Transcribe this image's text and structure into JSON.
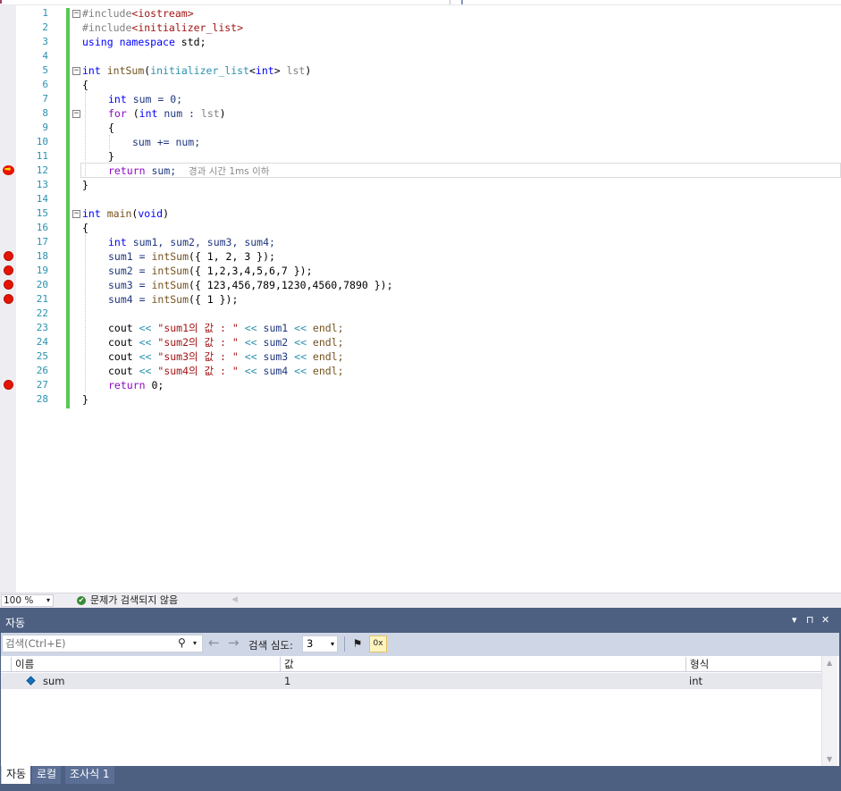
{
  "editor": {
    "line_numbers": [
      "1",
      "2",
      "3",
      "4",
      "5",
      "6",
      "7",
      "8",
      "9",
      "10",
      "11",
      "12",
      "13",
      "14",
      "15",
      "16",
      "17",
      "18",
      "19",
      "20",
      "21",
      "22",
      "23",
      "24",
      "25",
      "26",
      "27",
      "28"
    ],
    "lines": {
      "l1_pp": "#include",
      "l1_inc": "<iostream>",
      "l2_pp": "#include",
      "l2_inc": "<initializer_list>",
      "l3_kw1": "using",
      "l3_kw2": "namespace",
      "l3_rest": " std;",
      "l5_kw": "int",
      "l5_fn": "intSum",
      "l5_p1": "(",
      "l5_ty": "initializer_list",
      "l5_p2": "<",
      "l5_kw2": "int",
      "l5_p3": "> ",
      "l5_var": "lst",
      "l5_p4": ")",
      "l6": "{",
      "l7_kw": "int",
      "l7_rest": " sum = 0;",
      "l8_kw": "for",
      "l8_p1": " (",
      "l8_kw2": "int",
      "l8_p2": " num : ",
      "l8_var": "lst",
      "l8_p3": ")",
      "l9": "{",
      "l10": "sum += num;",
      "l11": "}",
      "l12_kw": "return",
      "l12_rest": " sum;",
      "l12_hint": "경과 시간 1ms 이하",
      "l13": "}",
      "l15_kw": "int",
      "l15_fn": "main",
      "l15_p1": "(",
      "l15_kw2": "void",
      "l15_p2": ")",
      "l16": "{",
      "l17_kw": "int",
      "l17_rest": " sum1, sum2, sum3, sum4;",
      "l18_a": "sum1 = ",
      "l18_fn": "intSum",
      "l18_b": "({ 1, 2, 3 });",
      "l19_a": "sum2 = ",
      "l19_fn": "intSum",
      "l19_b": "({ 1,2,3,4,5,6,7 });",
      "l20_a": "sum3 = ",
      "l20_fn": "intSum",
      "l20_b": "({ 123,456,789,1230,4560,7890 });",
      "l21_a": "sum4 = ",
      "l21_fn": "intSum",
      "l21_b": "({ 1 });",
      "l23_a": "cout ",
      "l23_op": "<<",
      "l23_str": " \"sum1의 값 : \" ",
      "l23_op2": "<<",
      "l23_b": " sum1 ",
      "l23_op3": "<<",
      "l23_c": " endl;",
      "l24_a": "cout ",
      "l24_op": "<<",
      "l24_str": " \"sum2의 값 : \" ",
      "l24_op2": "<<",
      "l24_b": " sum2 ",
      "l24_op3": "<<",
      "l24_c": " endl;",
      "l25_a": "cout ",
      "l25_op": "<<",
      "l25_str": " \"sum3의 값 : \" ",
      "l25_op2": "<<",
      "l25_b": " sum3 ",
      "l25_op3": "<<",
      "l25_c": " endl;",
      "l26_a": "cout ",
      "l26_op": "<<",
      "l26_str": " \"sum4의 값 : \" ",
      "l26_op2": "<<",
      "l26_b": " sum4 ",
      "l26_op3": "<<",
      "l26_c": " endl;",
      "l27_kw": "return",
      "l27_rest": " 0;",
      "l28": "}"
    },
    "fold_glyph": "−",
    "ip_glyph": "➡"
  },
  "status": {
    "zoom": "100 %",
    "issues": "문제가 검색되지 않음",
    "issues_glyph": "✔",
    "scroll_left_glyph": "◀"
  },
  "autos": {
    "title": "자동",
    "title_buttons": [
      "▾",
      "⊓",
      "✕"
    ],
    "search_placeholder": "검색(Ctrl+E)",
    "search_glyph": "⚲",
    "dropdown_glyph": "▾",
    "back_glyph": "←",
    "forward_glyph": "→",
    "depth_label": "검색 심도:",
    "depth_value": "3",
    "filter_glyph": "⚑",
    "hex_glyph": "0x",
    "columns": [
      "이름",
      "값",
      "형식"
    ],
    "rows": [
      {
        "name": "sum",
        "value": "1",
        "type": "int"
      }
    ],
    "scroll_up_glyph": "▲",
    "scroll_down_glyph": "▼"
  },
  "tabs": [
    "자동",
    "로컬",
    "조사식 1"
  ],
  "colors": {
    "breakpoint": "#e51400",
    "change_bar": "#57c957",
    "toolwindow": "#4d6082"
  }
}
